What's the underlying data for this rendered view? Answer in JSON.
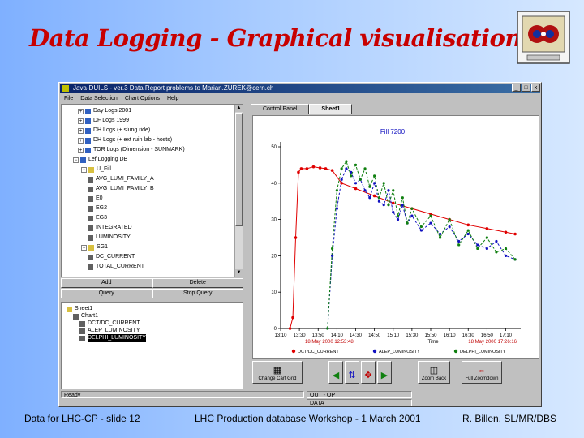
{
  "slide": {
    "title": "Data Logging - Graphical visualisation",
    "footer_left": "Data for LHC-CP - slide 12",
    "footer_center": "LHC Production database Workshop - 1 March 2001",
    "footer_right": "R. Billen, SL/MR/DBS",
    "colors": {
      "title": "#c80000",
      "background": "#a9ccff"
    }
  },
  "app": {
    "title": "Java-DUILS - ver.3 Data   Report problems to Marian.ZUREK@cern.ch",
    "menu": [
      "File",
      "Data Selection",
      "Chart Options",
      "Help"
    ],
    "window_buttons": [
      "_",
      "□",
      "x"
    ],
    "tree": [
      {
        "label": "Day Logs 2001",
        "type": "db"
      },
      {
        "label": "DF Logs 1999",
        "type": "db"
      },
      {
        "label": "DH Logs   (+ slung ride)",
        "type": "db"
      },
      {
        "label": "DH Logs   (+ ext ruin lab - hosts)",
        "type": "db"
      },
      {
        "label": "TOR Logs   (Dimension - SUNMARK)",
        "type": "db"
      },
      {
        "label": "Lef Logging DB",
        "type": "db-open"
      },
      {
        "label": "U_Fill",
        "type": "folder"
      },
      {
        "label": "AVG_LUMI_FAMILY_A",
        "type": "file"
      },
      {
        "label": "AVG_LUMI_FAMILY_B",
        "type": "file"
      },
      {
        "label": "E0",
        "type": "file"
      },
      {
        "label": "EG2",
        "type": "file"
      },
      {
        "label": "EG3",
        "type": "file"
      },
      {
        "label": "INTEGRATED",
        "type": "file"
      },
      {
        "label": "LUMINOSITY",
        "type": "file"
      },
      {
        "label": "SG1",
        "type": "folder"
      },
      {
        "label": "DC_CURRENT",
        "type": "file"
      },
      {
        "label": "TOTAL_CURRENT",
        "type": "file"
      }
    ],
    "buttons": {
      "add": "Add",
      "delete": "Delete",
      "query": "Query",
      "stop_query": "Stop Query"
    },
    "sheet_tree": [
      {
        "label": "Sheet1",
        "type": "sheet"
      },
      {
        "label": "Chart1",
        "type": "chart"
      },
      {
        "label": "DCT/DC_CURRENT",
        "type": "item"
      },
      {
        "label": "ALEP_LUMINOSITY",
        "type": "item"
      },
      {
        "label": "DELPHI_LUMINOSITY",
        "type": "item-selected"
      }
    ],
    "tabs": [
      "Control Panel",
      "Sheet1"
    ],
    "status": {
      "left": "Ready",
      "mid1": "OUT - OP",
      "mid2": "DATA"
    },
    "toolbar": [
      {
        "label": "Change Cart Grid",
        "icon": "grid-icon"
      },
      {
        "label": "",
        "icon": "arrow-left-icon"
      },
      {
        "label": "",
        "icon": "fit-icon"
      },
      {
        "label": "",
        "icon": "zoom-in-icon"
      },
      {
        "label": "",
        "icon": "arrow-right-icon"
      },
      {
        "label": "Zoom Back",
        "icon": "zoom-back-icon"
      },
      {
        "label": "Full Zoomdown",
        "icon": "zoom-full-icon"
      }
    ]
  },
  "chart_data": {
    "type": "line",
    "title": "Fill 7200",
    "x_ticks": [
      "13:10",
      "13:30",
      "13:50",
      "14:10",
      "14:30",
      "14:50",
      "15:10",
      "15:30",
      "15:50",
      "16:10",
      "16:30",
      "16:50",
      "17:10"
    ],
    "time_label_left": "18 May 2000 12:53:48",
    "time_label_center": "Time",
    "time_label_right": "18 May 2000 17:26:16",
    "y_ticks": [
      "0",
      "10",
      "20",
      "30",
      "40",
      "50"
    ],
    "ylim": [
      0,
      50
    ],
    "xlim": [
      "13:10",
      "17:26"
    ],
    "series": [
      {
        "name": "DCT/DC_CURRENT",
        "color": "#e00000",
        "x": [
          "13:20",
          "13:23",
          "13:26",
          "13:29",
          "13:32",
          "13:38",
          "13:45",
          "13:52",
          "13:58",
          "14:05",
          "14:15",
          "14:30",
          "14:50",
          "15:10",
          "15:30",
          "15:50",
          "16:10",
          "16:30",
          "16:50",
          "17:10",
          "17:20"
        ],
        "y": [
          0,
          3,
          25,
          43,
          44,
          44,
          44.5,
          44.2,
          44,
          43.5,
          40,
          38.5,
          36.5,
          34.5,
          33,
          31.5,
          30,
          28.5,
          27.5,
          26.5,
          26
        ]
      },
      {
        "name": "ALEP_LUMINOSITY",
        "color": "#1010c0",
        "x": [
          "14:00",
          "14:05",
          "14:10",
          "14:15",
          "14:20",
          "14:25",
          "14:30",
          "14:35",
          "14:40",
          "14:45",
          "14:50",
          "14:55",
          "15:00",
          "15:05",
          "15:10",
          "15:15",
          "15:20",
          "15:25",
          "15:30",
          "15:40",
          "15:50",
          "16:00",
          "16:10",
          "16:20",
          "16:30",
          "16:40",
          "16:50",
          "17:00",
          "17:10",
          "17:20"
        ],
        "y": [
          0,
          20,
          33,
          41,
          44,
          43,
          40,
          41,
          38,
          36,
          40,
          35,
          34,
          38,
          32,
          30,
          34,
          29,
          31,
          27,
          29,
          26,
          28,
          24,
          26,
          23,
          22,
          24,
          20,
          19
        ]
      },
      {
        "name": "DELPHI_LUMINOSITY",
        "color": "#108010",
        "x": [
          "14:00",
          "14:05",
          "14:10",
          "14:15",
          "14:20",
          "14:25",
          "14:30",
          "14:35",
          "14:40",
          "14:45",
          "14:50",
          "14:55",
          "15:00",
          "15:05",
          "15:10",
          "15:15",
          "15:20",
          "15:25",
          "15:30",
          "15:40",
          "15:50",
          "16:00",
          "16:10",
          "16:20",
          "16:30",
          "16:40",
          "16:50",
          "17:00",
          "17:10",
          "17:20"
        ],
        "y": [
          0,
          22,
          38,
          44,
          46,
          42,
          45,
          41,
          44,
          39,
          42,
          36,
          40,
          34,
          38,
          31,
          36,
          29,
          33,
          28,
          31,
          25,
          30,
          23,
          27,
          22,
          25,
          21,
          22,
          19
        ]
      }
    ]
  }
}
